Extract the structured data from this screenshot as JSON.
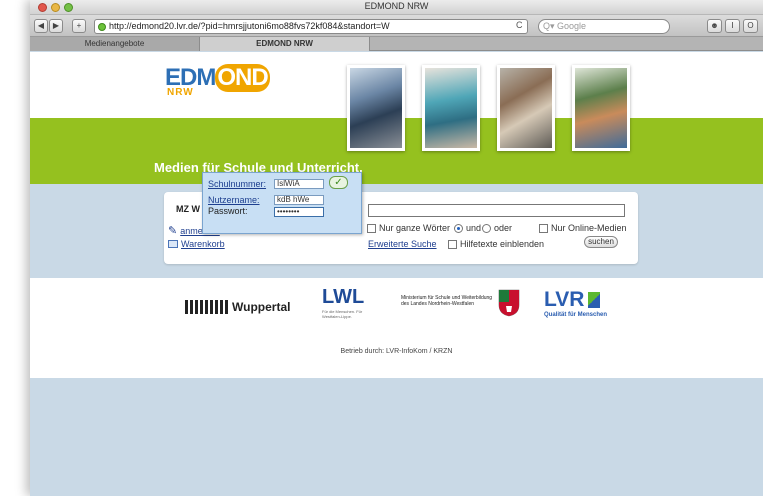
{
  "window": {
    "title": "EDMOND NRW"
  },
  "browser": {
    "url": "http://edmond20.lvr.de/?pid=hmrsjjutoni6mo88fvs72kf084&standort=W",
    "search_placeholder": "Q▾ Google",
    "reload_glyph": "C",
    "back_glyph": "◀",
    "forward_glyph": "▶",
    "add_glyph": "+",
    "tabs": [
      {
        "label": "Medienangebote"
      },
      {
        "label": "EDMOND NRW"
      }
    ],
    "right_buttons": [
      {
        "glyph": "☻"
      },
      {
        "glyph": "Ⅰ"
      },
      {
        "glyph": "O"
      }
    ]
  },
  "page": {
    "logo": {
      "text_a": "EDM",
      "text_ond": "OND",
      "text_b": "",
      "sub": "NRW"
    },
    "tagline": "Medien für Schule und Unterricht.",
    "search": {
      "mz_label": "MZ W",
      "options": {
        "whole_words": "Nur ganze Wörter",
        "and": "und",
        "or": "oder",
        "online_only": "Nur Online-Medien",
        "advanced": "Erweiterte Suche",
        "help_texts": "Hilfetexte einblenden",
        "submit": "suchen"
      },
      "login_link": "anmelden",
      "cart_link": "Warenkorb"
    },
    "login_popup": {
      "school_label": "Schulnummer:",
      "school_value": "IslWiA",
      "user_label": "Nutzername:",
      "user_value": "kdB   hWe",
      "password_label": "Passwort:",
      "password_value": "••••••••",
      "ok_glyph": "✓"
    },
    "partners": {
      "wuppertal": "Wuppertal",
      "lwl": "LWL",
      "lwl_sub": "Für die Menschen. Für Westfalen-Lippe.",
      "ministry": "Ministerium für Schule und Weiterbildung des Landes Nordrhein-Westfalen",
      "lvr": "LVR",
      "lvr_sub": "Qualität für Menschen"
    },
    "footer": "Betrieb durch:   LVR-InfoKom   /   KRZN"
  }
}
